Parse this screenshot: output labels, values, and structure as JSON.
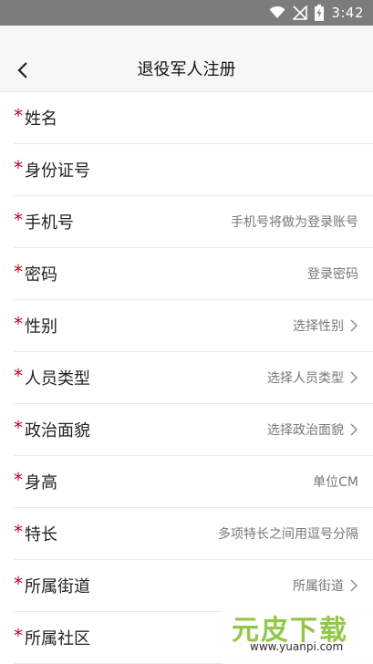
{
  "status_bar": {
    "time": "3:42"
  },
  "header": {
    "title": "退役军人注册"
  },
  "form_rows": [
    {
      "label": "姓名",
      "required": "*",
      "value": "",
      "chevron": false
    },
    {
      "label": "身份证号",
      "required": "*",
      "value": "",
      "chevron": false
    },
    {
      "label": "手机号",
      "required": "*",
      "value": "手机号将做为登录账号",
      "chevron": false
    },
    {
      "label": "密码",
      "required": "*",
      "value": "登录密码",
      "chevron": false
    },
    {
      "label": "性别",
      "required": "*",
      "value": "选择性别",
      "chevron": true
    },
    {
      "label": "人员类型",
      "required": "*",
      "value": "选择人员类型",
      "chevron": true
    },
    {
      "label": "政治面貌",
      "required": "*",
      "value": "选择政治面貌",
      "chevron": true
    },
    {
      "label": "身高",
      "required": "*",
      "value": "单位CM",
      "chevron": false
    },
    {
      "label": "特长",
      "required": "*",
      "value": "多项特长之间用逗号分隔",
      "chevron": false
    },
    {
      "label": "所属街道",
      "required": "*",
      "value": "所属街道",
      "chevron": true
    },
    {
      "label": "所属社区",
      "required": "*",
      "value": "",
      "chevron": false
    }
  ],
  "watermark": {
    "brand": "元皮下载",
    "url": "www.yuanpi.com"
  },
  "colors": {
    "required": "#d0021b",
    "status_bar": "#7c7c7c",
    "header_bg": "#f7f7f7"
  }
}
